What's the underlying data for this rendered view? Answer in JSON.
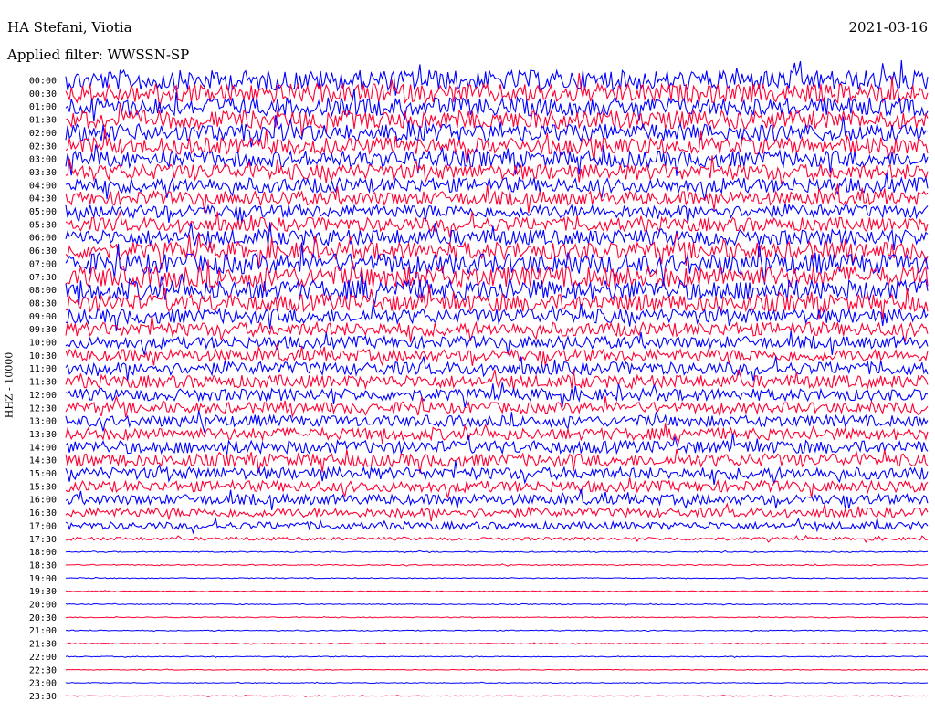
{
  "header": {
    "station": "HA Stefani, Viotia",
    "filter": "Applied filter: WWSSN-SP",
    "date": "2021-03-16"
  },
  "chart_data": {
    "type": "line",
    "title": "HA Stefani, Viotia",
    "subtitle": "Applied filter: WWSSN-SP",
    "date": "2021-03-16",
    "ylabel": "HHZ - 10000",
    "xlabel": "",
    "y_tick_labels": [
      "00:00",
      "00:30",
      "01:00",
      "01:30",
      "02:00",
      "02:30",
      "03:00",
      "03:30",
      "04:00",
      "04:30",
      "05:00",
      "05:30",
      "06:00",
      "06:30",
      "07:00",
      "07:30",
      "08:00",
      "08:30",
      "09:00",
      "09:30",
      "10:00",
      "10:30",
      "11:00",
      "11:30",
      "12:00",
      "12:30",
      "13:00",
      "13:30",
      "14:00",
      "14:30",
      "15:00",
      "15:30",
      "16:00",
      "16:30",
      "17:00",
      "17:30",
      "18:00",
      "18:30",
      "19:00",
      "19:30",
      "20:00",
      "20:30",
      "21:00",
      "21:30",
      "22:00",
      "22:30",
      "23:00",
      "23:30"
    ],
    "trace_colors": [
      "#0000ff",
      "#ff0033"
    ],
    "relative_amplitude": [
      2.2,
      2.1,
      2.0,
      2.0,
      1.9,
      1.8,
      1.8,
      1.7,
      1.6,
      1.5,
      1.4,
      1.5,
      1.7,
      1.9,
      2.2,
      2.3,
      2.2,
      1.9,
      1.6,
      1.5,
      1.3,
      1.3,
      1.4,
      1.4,
      1.3,
      1.2,
      1.2,
      1.3,
      1.4,
      1.4,
      1.3,
      1.2,
      1.1,
      1.0,
      0.8,
      0.35,
      0.12,
      0.12,
      0.1,
      0.1,
      0.1,
      0.1,
      0.1,
      0.1,
      0.1,
      0.08,
      0.08,
      0.08
    ],
    "grid": false,
    "legend": "none"
  }
}
